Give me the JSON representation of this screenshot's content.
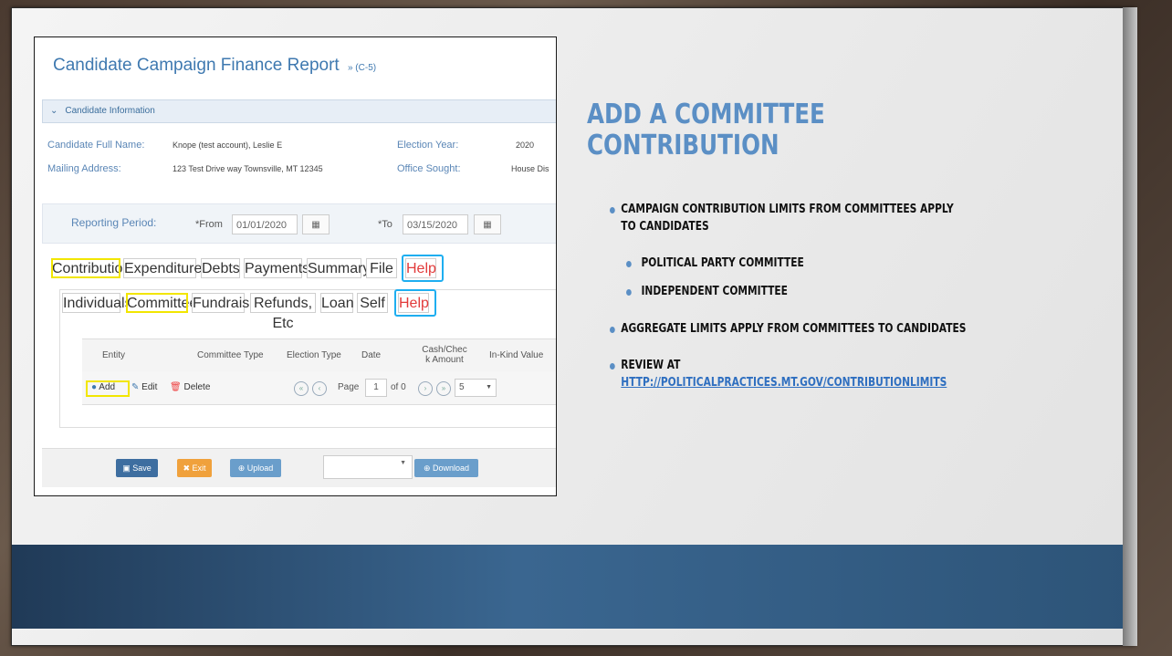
{
  "screenshot": {
    "title": "Candidate Campaign Finance Report",
    "title_suffix": "» (C-5)",
    "section_header": "Candidate Information",
    "fields": {
      "full_name_label": "Candidate Full Name:",
      "full_name_value": "Knope (test account), Leslie E",
      "election_year_label": "Election Year:",
      "election_year_value": "2020",
      "mailing_label": "Mailing Address:",
      "mailing_value": "123 Test Drive way Townsville, MT 12345",
      "office_label": "Office Sought:",
      "office_value": "House Dis"
    },
    "reporting": {
      "label": "Reporting Period:",
      "from_label": "*From",
      "from_value": "01/01/2020",
      "to_label": "*To",
      "to_value": "03/15/2020"
    },
    "main_tabs": [
      "Contributions",
      "Expenditures",
      "Debts",
      "Payments",
      "Summary",
      "File",
      "Help"
    ],
    "sub_tabs": [
      "Individuals",
      "Committee",
      "Fundraiser",
      "Refunds, Etc",
      "Loan",
      "Self",
      "Help"
    ],
    "grid_columns": [
      "Entity",
      "Committee Type",
      "Election Type",
      "Date",
      "Cash/Chec k Amount",
      "In-Kind Value"
    ],
    "grid_actions": {
      "add": "Add",
      "edit": "Edit",
      "delete": "Delete"
    },
    "pager": {
      "page_label": "Page",
      "page_value": "1",
      "of_label": "of 0",
      "page_size": "5"
    },
    "buttons": {
      "save": "Save",
      "exit": "Exit",
      "upload": "Upload",
      "download": "Download"
    },
    "colors": {
      "highlight_yellow": "#f2e600",
      "highlight_blue": "#1eaef0",
      "title_blue": "#3f79b0"
    }
  },
  "slide": {
    "heading_line1": "ADD A COMMITTEE",
    "heading_line2": "CONTRIBUTION",
    "b1_line1": "CAMPAIGN CONTRIBUTION LIMITS FROM COMMITTEES APPLY",
    "b1_line2": "TO CANDIDATES",
    "b1_sub1": "POLITICAL PARTY COMMITTEE",
    "b1_sub2": "INDEPENDENT COMMITTEE",
    "b2": "AGGREGATE LIMITS APPLY FROM COMMITTEES TO CANDIDATES",
    "b3": "REVIEW AT",
    "b3_link": "HTTP://POLITICALPRACTICES.MT.GOV/CONTRIBUTIONLIMITS",
    "accent": "#5b8fc5"
  }
}
